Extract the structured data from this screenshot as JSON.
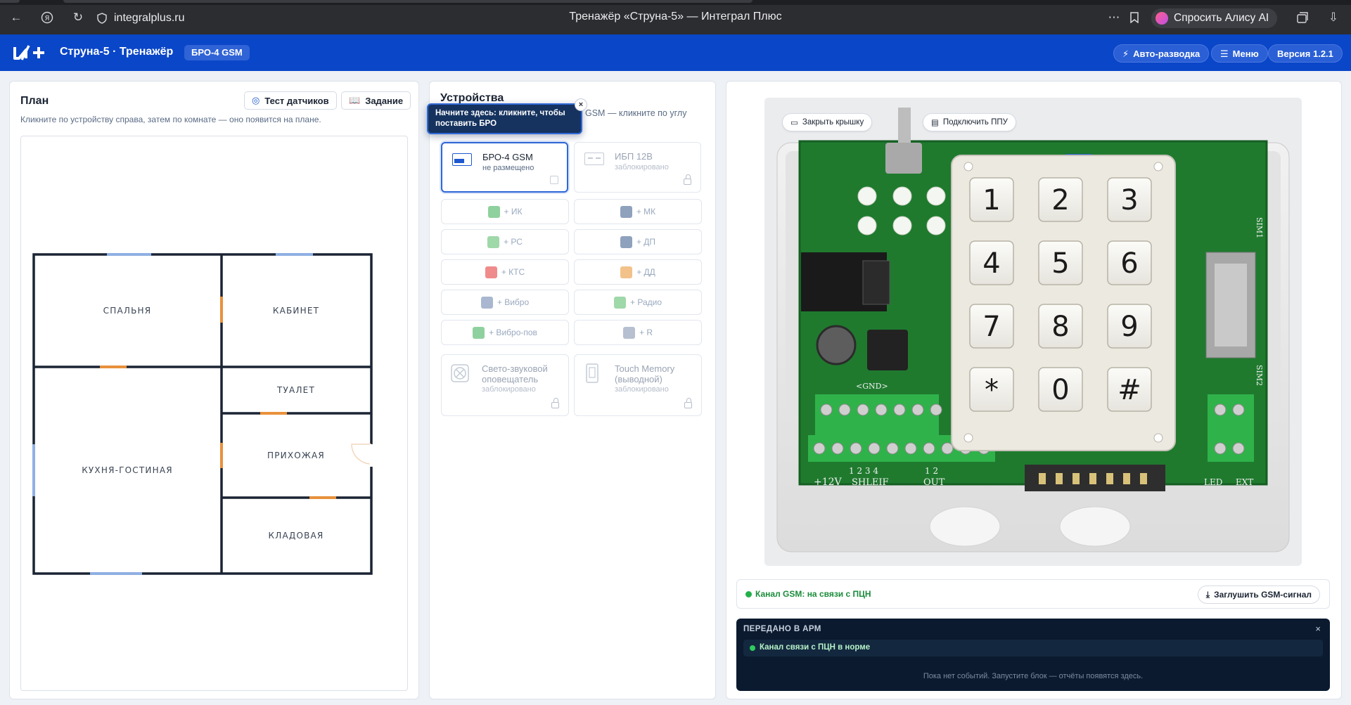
{
  "browser": {
    "url": "integralplus.ru",
    "page_title": "Тренажёр «Струна-5» — Интеграл Плюс",
    "alice_label": "Спросить Алису AI"
  },
  "appbar": {
    "title": "Струна-5 · Тренажёр",
    "device_badge": "БРО-4 GSM",
    "auto_wiring": "Авто-разводка",
    "menu": "Меню",
    "version": "Версия 1.2.1"
  },
  "plan": {
    "title": "План",
    "hint": "Кликните по устройству справа, затем по комнате — оно появится на плане.",
    "test_button": "Тест датчиков",
    "task_button": "Задание",
    "rooms": {
      "bedroom": "СПАЛЬНЯ",
      "office": "КАБИНЕТ",
      "toilet": "ТУАЛЕТ",
      "hall": "ПРИХОЖАЯ",
      "kitchen": "КУХНЯ-ГОСТИНАЯ",
      "storage": "КЛАДОВАЯ"
    }
  },
  "devices": {
    "title": "Устройства",
    "hint_tail": "GSM — кликните по углу",
    "tooltip": "Начните здесь: кликните, чтобы поставить БРО",
    "tooltip_close": "×",
    "main": [
      {
        "name": "БРО-4 GSM",
        "status": "не размещено"
      },
      {
        "name": "ИБП 12В",
        "status": "заблокировано"
      }
    ],
    "sensors": [
      {
        "label": "+ ИК",
        "color": "#8fd19e"
      },
      {
        "label": "+ МК",
        "color": "#8ea1bd"
      },
      {
        "label": "+ РС",
        "color": "#9fd8a9"
      },
      {
        "label": "+ ДП",
        "color": "#8ea1bd"
      },
      {
        "label": "+ КТС",
        "color": "#f08b8b"
      },
      {
        "label": "+ ДД",
        "color": "#f2c28a"
      },
      {
        "label": "+ Вибро",
        "color": "#a9b8d0"
      },
      {
        "label": "+ Радио",
        "color": "#9fd8a9"
      },
      {
        "label": "+ Вибро-пов",
        "color": "#8fd19e"
      },
      {
        "label": "+ R",
        "color": "#b6c0d0"
      }
    ],
    "extra": [
      {
        "name": "Свето-звуковой оповещатель",
        "status": "заблокировано"
      },
      {
        "name": "Touch Memory (выводной)",
        "status": "заблокировано"
      }
    ]
  },
  "photo": {
    "close_lid": "Закрыть крышку",
    "connect_ppu": "Подключить ППУ",
    "keypad": [
      "1",
      "2",
      "3",
      "4",
      "5",
      "6",
      "7",
      "8",
      "9",
      "*",
      "0",
      "#"
    ],
    "board_labels": {
      "power": "+12V",
      "shleif": "SHLEIF",
      "shleif_nums": "1 2 3 4",
      "out": "OUT",
      "out_nums": "1 2",
      "led": "LED",
      "ext": "EXT",
      "gnd": "<GND>",
      "sim1": "SIM1",
      "sim2": "SIM2"
    }
  },
  "status": {
    "channel": "Канал GSM: на связи с ПЦН",
    "mute_button": "Заглушить GSM-сигнал"
  },
  "arm": {
    "title": "ПЕРЕДАНО В АРМ",
    "close": "×",
    "event": "Канал связи с ПЦН в норме",
    "empty": "Пока нет событий. Запустите блок — отчёты появятся здесь."
  }
}
